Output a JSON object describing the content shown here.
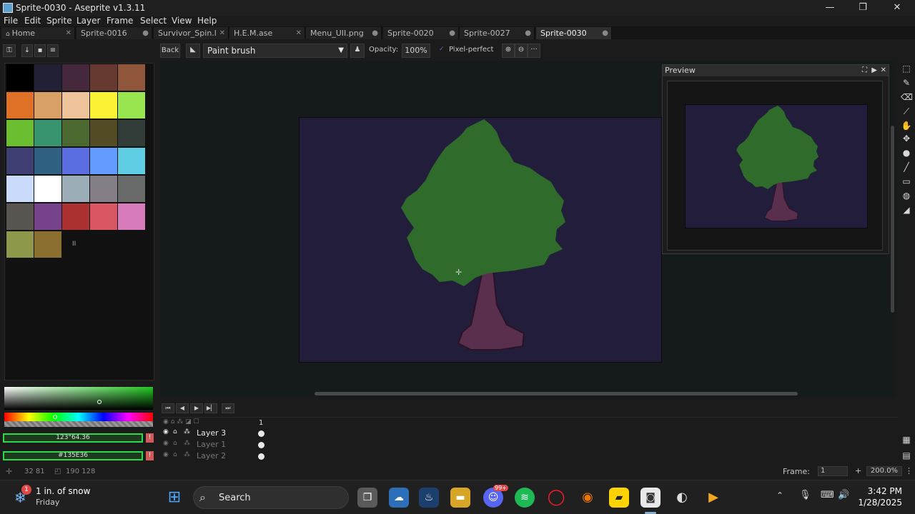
{
  "window": {
    "title": "Sprite-0030 - Aseprite v1.3.11",
    "minimize": "—",
    "restore": "❐",
    "close": "✕"
  },
  "menu": [
    "File",
    "Edit",
    "Sprite",
    "Layer",
    "Frame",
    "Select",
    "View",
    "Help"
  ],
  "tabs": [
    {
      "label": "Home",
      "icon": "home-icon"
    },
    {
      "label": "Sprite-0016"
    },
    {
      "label": "Survivor_Spin.l"
    },
    {
      "label": "H.E.M.ase"
    },
    {
      "label": "Menu_UII.png"
    },
    {
      "label": "Sprite-0020"
    },
    {
      "label": "Sprite-0027"
    },
    {
      "label": "Sprite-0030"
    }
  ],
  "toolbar": {
    "back_label": "Back",
    "brush_label": "Paint brush",
    "opacity_label": "Opacity:",
    "opacity_value": "100%",
    "pixel_perfect_label": "Pixel-perfect",
    "more_label": "···"
  },
  "palette": [
    "#000000",
    "#222034",
    "#45283c",
    "#663931",
    "#8f563b",
    "#df7126",
    "#d9a066",
    "#eec39a",
    "#fbf236",
    "#99e550",
    "#6abe30",
    "#37946e",
    "#4b692f",
    "#524b24",
    "#323c39",
    "#3f3f74",
    "#306082",
    "#5b6ee1",
    "#639bff",
    "#5fcde4",
    "#cbdbfc",
    "#ffffff",
    "#9badb7",
    "#847e87",
    "#696a6a",
    "#595652",
    "#76428a",
    "#ac3232",
    "#d95763",
    "#d77bba",
    "#8f974a",
    "#8a6f30"
  ],
  "palette_mark": "II",
  "preview": {
    "title": "Preview"
  },
  "colors": {
    "foreground_field": "123°64.36",
    "background_field": "#135E36",
    "warn_icon": "!",
    "sky": "#221d3a",
    "foliage": "#2f6b2a",
    "trunk": "#5a2f4e"
  },
  "timeline": {
    "frame_number": "1",
    "layers": [
      "Layer 3",
      "Layer 1",
      "Layer 2"
    ]
  },
  "status": {
    "coords": "32 81",
    "size": "190 128",
    "frame_label": "Frame:",
    "frame_value": "1",
    "zoom": "200.0%"
  },
  "taskbar": {
    "weather_title": "1 in. of snow",
    "weather_sub": "Friday",
    "weather_badge": "1",
    "search": "Search",
    "time": "3:42 PM",
    "date": "1/28/2025",
    "discord_badge": "99+"
  }
}
